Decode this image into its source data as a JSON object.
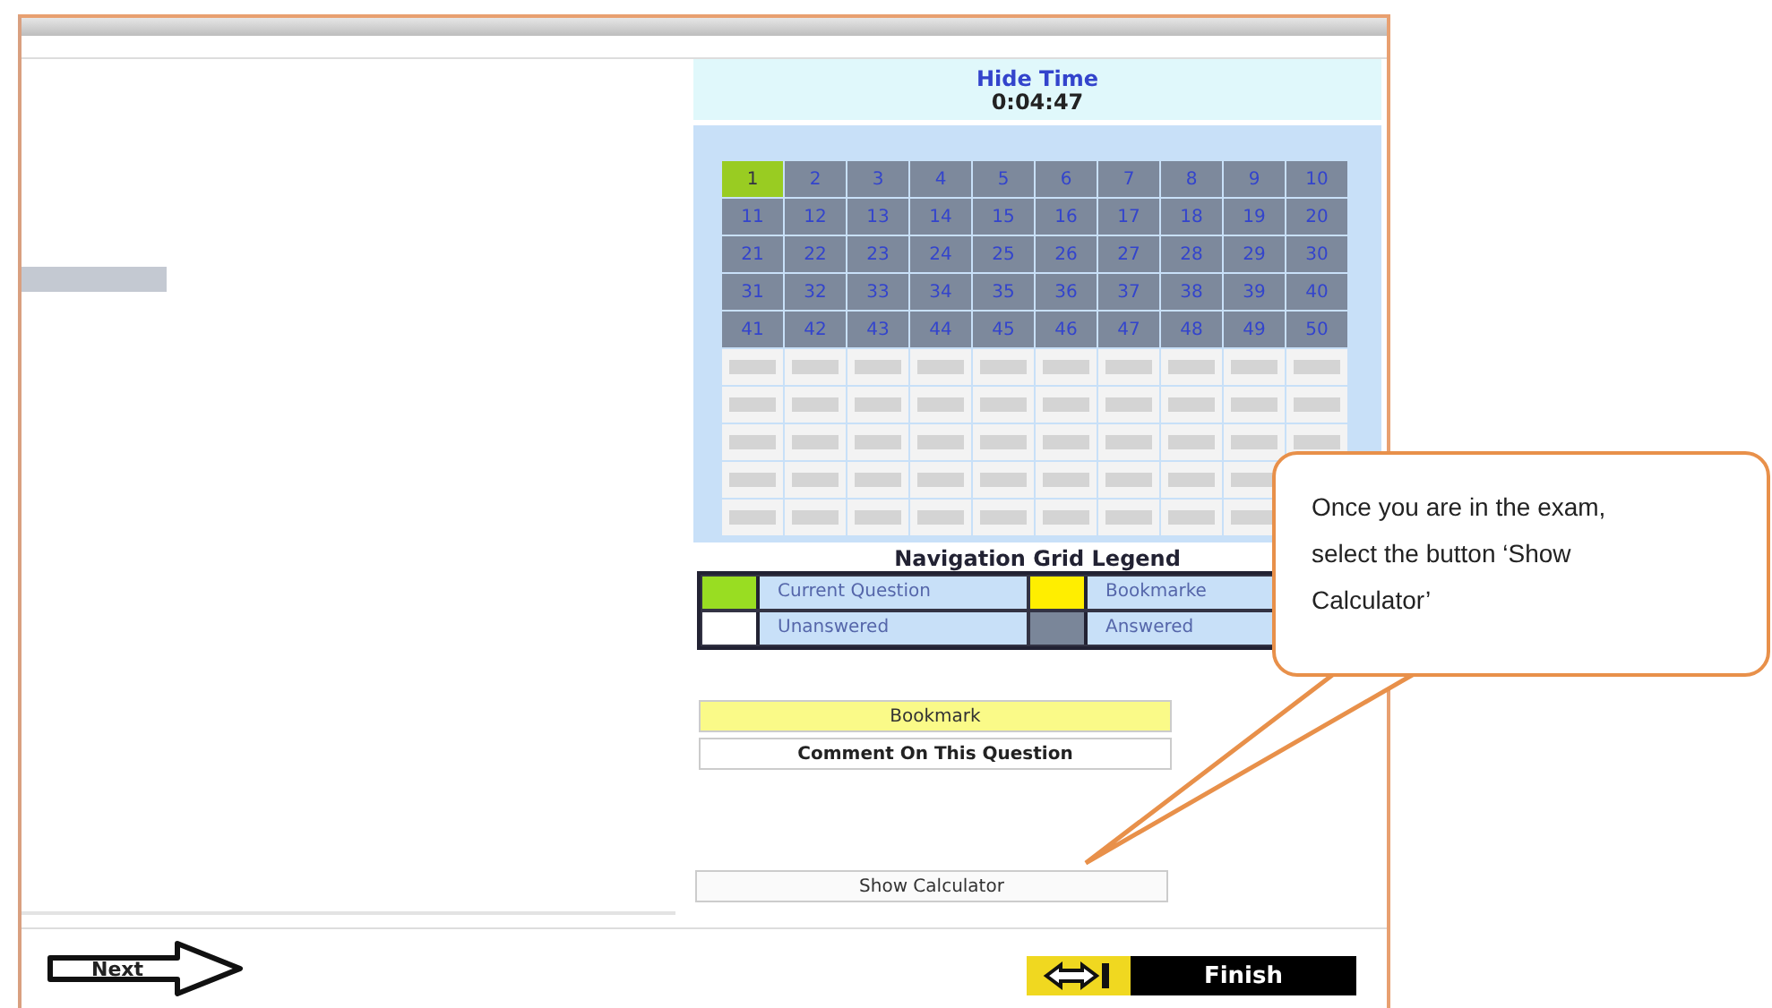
{
  "timer": {
    "toggle": "Hide Time",
    "elapsed": "0:04:47"
  },
  "grid": {
    "cells": [
      {
        "kind": "number",
        "label": "1",
        "current": true
      },
      {
        "kind": "number",
        "label": "2",
        "current": false,
        "answered": true
      },
      {
        "kind": "number",
        "label": "3",
        "current": false,
        "answered": true
      },
      {
        "kind": "number",
        "label": "4",
        "current": false,
        "answered": true
      },
      {
        "kind": "number",
        "label": "5",
        "current": false,
        "answered": true
      },
      {
        "kind": "number",
        "label": "6",
        "current": false,
        "answered": true
      },
      {
        "kind": "number",
        "label": "7",
        "current": false,
        "answered": true
      },
      {
        "kind": "number",
        "label": "8",
        "current": false,
        "answered": true
      },
      {
        "kind": "number",
        "label": "9",
        "current": false,
        "answered": true
      },
      {
        "kind": "number",
        "label": "10",
        "current": false,
        "answered": true
      },
      {
        "kind": "number",
        "label": "11",
        "current": false,
        "answered": true
      },
      {
        "kind": "number",
        "label": "12",
        "current": false,
        "answered": true
      },
      {
        "kind": "number",
        "label": "13",
        "current": false,
        "answered": true
      },
      {
        "kind": "number",
        "label": "14",
        "current": false,
        "answered": true
      },
      {
        "kind": "number",
        "label": "15",
        "current": false,
        "answered": true
      },
      {
        "kind": "number",
        "label": "16",
        "current": false,
        "answered": true
      },
      {
        "kind": "number",
        "label": "17",
        "current": false,
        "answered": true
      },
      {
        "kind": "number",
        "label": "18",
        "current": false,
        "answered": true
      },
      {
        "kind": "number",
        "label": "19",
        "current": false,
        "answered": true
      },
      {
        "kind": "number",
        "label": "20",
        "current": false,
        "answered": true
      },
      {
        "kind": "number",
        "label": "21",
        "current": false,
        "answered": true
      },
      {
        "kind": "number",
        "label": "22",
        "current": false,
        "answered": true
      },
      {
        "kind": "number",
        "label": "23",
        "current": false,
        "answered": true
      },
      {
        "kind": "number",
        "label": "24",
        "current": false,
        "answered": true
      },
      {
        "kind": "number",
        "label": "25",
        "current": false,
        "answered": true
      },
      {
        "kind": "number",
        "label": "26",
        "current": false,
        "answered": true
      },
      {
        "kind": "number",
        "label": "27",
        "current": false,
        "answered": true
      },
      {
        "kind": "number",
        "label": "28",
        "current": false,
        "answered": true
      },
      {
        "kind": "number",
        "label": "29",
        "current": false,
        "answered": true
      },
      {
        "kind": "number",
        "label": "30",
        "current": false,
        "answered": true
      },
      {
        "kind": "number",
        "label": "31",
        "current": false,
        "answered": true
      },
      {
        "kind": "number",
        "label": "32",
        "current": false,
        "answered": true
      },
      {
        "kind": "number",
        "label": "33",
        "current": false,
        "answered": true
      },
      {
        "kind": "number",
        "label": "34",
        "current": false,
        "answered": true
      },
      {
        "kind": "number",
        "label": "35",
        "current": false,
        "answered": true
      },
      {
        "kind": "number",
        "label": "36",
        "current": false,
        "answered": true
      },
      {
        "kind": "number",
        "label": "37",
        "current": false,
        "answered": true
      },
      {
        "kind": "number",
        "label": "38",
        "current": false,
        "answered": true
      },
      {
        "kind": "number",
        "label": "39",
        "current": false,
        "answered": true
      },
      {
        "kind": "number",
        "label": "40",
        "current": false,
        "answered": true
      },
      {
        "kind": "number",
        "label": "41",
        "current": false,
        "answered": true
      },
      {
        "kind": "number",
        "label": "42",
        "current": false,
        "answered": true
      },
      {
        "kind": "number",
        "label": "43",
        "current": false,
        "answered": true
      },
      {
        "kind": "number",
        "label": "44",
        "current": false,
        "answered": true
      },
      {
        "kind": "number",
        "label": "45",
        "current": false,
        "answered": true
      },
      {
        "kind": "number",
        "label": "46",
        "current": false,
        "answered": true
      },
      {
        "kind": "number",
        "label": "47",
        "current": false,
        "answered": true
      },
      {
        "kind": "number",
        "label": "48",
        "current": false,
        "answered": true
      },
      {
        "kind": "number",
        "label": "49",
        "current": false,
        "answered": true
      },
      {
        "kind": "number",
        "label": "50",
        "current": false,
        "answered": true
      },
      {
        "kind": "empty"
      },
      {
        "kind": "empty"
      },
      {
        "kind": "empty"
      },
      {
        "kind": "empty"
      },
      {
        "kind": "empty"
      },
      {
        "kind": "empty"
      },
      {
        "kind": "empty"
      },
      {
        "kind": "empty"
      },
      {
        "kind": "empty"
      },
      {
        "kind": "empty"
      },
      {
        "kind": "empty"
      },
      {
        "kind": "empty"
      },
      {
        "kind": "empty"
      },
      {
        "kind": "empty"
      },
      {
        "kind": "empty"
      },
      {
        "kind": "empty"
      },
      {
        "kind": "empty"
      },
      {
        "kind": "empty"
      },
      {
        "kind": "empty"
      },
      {
        "kind": "empty"
      },
      {
        "kind": "empty"
      },
      {
        "kind": "empty"
      },
      {
        "kind": "empty"
      },
      {
        "kind": "empty"
      },
      {
        "kind": "empty"
      },
      {
        "kind": "empty"
      },
      {
        "kind": "empty"
      },
      {
        "kind": "empty"
      },
      {
        "kind": "empty"
      },
      {
        "kind": "empty"
      },
      {
        "kind": "empty"
      },
      {
        "kind": "empty"
      },
      {
        "kind": "empty"
      },
      {
        "kind": "empty"
      },
      {
        "kind": "empty"
      },
      {
        "kind": "empty"
      },
      {
        "kind": "empty"
      },
      {
        "kind": "empty"
      },
      {
        "kind": "empty"
      },
      {
        "kind": "covered"
      },
      {
        "kind": "empty"
      },
      {
        "kind": "empty"
      },
      {
        "kind": "empty"
      },
      {
        "kind": "empty"
      },
      {
        "kind": "empty"
      },
      {
        "kind": "empty"
      },
      {
        "kind": "empty"
      },
      {
        "kind": "empty"
      },
      {
        "kind": "empty"
      },
      {
        "kind": "covered"
      }
    ]
  },
  "legend": {
    "title": "Navigation Grid Legend",
    "items": [
      {
        "label": "Current Question",
        "color": "#99dd22"
      },
      {
        "label": "Bookmarke",
        "color": "#ffee00"
      },
      {
        "label": "Unanswered",
        "color": "#ffffff"
      },
      {
        "label": "Answered",
        "color": "#7a8699"
      }
    ]
  },
  "actions": [
    {
      "label": "Bookmark",
      "kind": "bookmark"
    },
    {
      "label": "Comment On This Question",
      "kind": "comment"
    }
  ],
  "calculator_button": "Show Calculator",
  "navigation": {
    "next": "Next",
    "finish": "Finish"
  },
  "callout": "Once you are in the exam, select the button ‘Show Calculator’"
}
